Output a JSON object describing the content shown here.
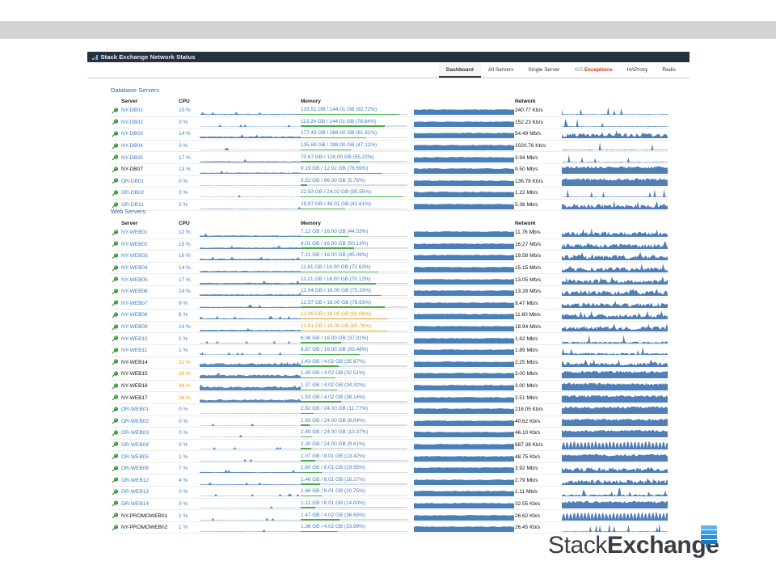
{
  "window": {
    "title": "Stack Exchange Network Status",
    "accent": "#3d7cbf",
    "warn": "#e69a20",
    "ok": "#4da84d"
  },
  "nav": {
    "tabs": [
      {
        "label": "Dashboard",
        "active": true
      },
      {
        "label": "All Servers"
      },
      {
        "label": "Single Server"
      },
      {
        "count": "455",
        "label": "Exceptions",
        "highlight": true
      },
      {
        "label": "HAProxy"
      },
      {
        "label": "Redis"
      }
    ]
  },
  "columns": {
    "server": "Server",
    "cpu": "CPU",
    "memory": "Memory",
    "network": "Network"
  },
  "database_servers": {
    "title": "Database Servers",
    "rows": [
      {
        "name": "NY-DB01",
        "cpu": "10 %",
        "mem": "133.51 GB / 144.01 GB (92.72%)",
        "mem_pct": 92.72,
        "net": "240.77 Kb/s",
        "cpu_level": 0.08,
        "net_style": "spiky"
      },
      {
        "name": "NY-DB02",
        "cpu": "0 %",
        "mem": "113.24 GB / 144.01 GB (78.64%)",
        "mem_pct": 78.64,
        "net": "152.23 Kb/s",
        "cpu_level": 0.03,
        "net_style": "spiky"
      },
      {
        "name": "NY-DB03",
        "cpu": "14 %",
        "mem": "177.43 GB / 288.00 GB (61.61%)",
        "mem_pct": 61.61,
        "net": "54.49 Mb/s",
        "cpu_level": 0.18,
        "net_style": "dense"
      },
      {
        "name": "NY-DB04",
        "cpu": "0 %",
        "mem": "135.69 GB / 288.00 GB (47.12%)",
        "mem_pct": 47.12,
        "net": "1020.76 Kb/s",
        "cpu_level": 0.03,
        "net_style": "spiky"
      },
      {
        "name": "NY-DB05",
        "cpu": "17 %",
        "mem": "70.67 GB / 128.00 GB (55.22%)",
        "mem_pct": 55.22,
        "net": "3.94 Mb/s",
        "cpu_level": 0.12,
        "net_style": "spiky"
      },
      {
        "name": "NY-DB07",
        "cpu": "13 %",
        "mem": "9.19 GB / 12.02 GB (76.59%)",
        "mem_pct": 76.59,
        "net": "9.50 Mb/s",
        "cpu_level": 0.12,
        "net_style": "full",
        "black": true
      },
      {
        "name": "OR-DB01",
        "cpu": "0 %",
        "mem": "5.52 GB / 96.00 GB (5.75%)",
        "mem_pct": 5.75,
        "net": "136.78 Kb/s",
        "cpu_level": 0.03,
        "net_style": "full"
      },
      {
        "name": "OR-DB02",
        "cpu": "0 %",
        "mem": "22.93 GB / 24.02 GB (95.55%)",
        "mem_pct": 95.55,
        "net": "1.22 Mb/s",
        "cpu_level": 0.03,
        "net_style": "spiky"
      },
      {
        "name": "OR-DB11",
        "cpu": "2 %",
        "mem": "19.97 GB / 48.01 GB (41.61%)",
        "mem_pct": 41.61,
        "net": "5.38 Mb/s",
        "cpu_level": 0.05,
        "net_style": "dense"
      }
    ]
  },
  "web_servers": {
    "title": "Web Servers",
    "rows": [
      {
        "name": "NY-WEB01",
        "cpu": "12 %",
        "mem": "7.12 GB / 16.00 GB (44.53%)",
        "mem_pct": 44.53,
        "net": "11.76 Mb/s",
        "cpu_level": 0.14,
        "net_style": "dense"
      },
      {
        "name": "NY-WEB02",
        "cpu": "15 %",
        "mem": "8.01 GB / 16.00 GB (50.13%)",
        "mem_pct": 50.13,
        "net": "16.27 Mb/s",
        "cpu_level": 0.15,
        "net_style": "dense"
      },
      {
        "name": "NY-WEB03",
        "cpu": "16 %",
        "mem": "7.21 GB / 16.00 GB (45.09%)",
        "mem_pct": 45.09,
        "net": "19.58 Mb/s",
        "cpu_level": 0.16,
        "net_style": "dense"
      },
      {
        "name": "NY-WEB04",
        "cpu": "14 %",
        "mem": "11.61 GB / 16.00 GB (72.63%)",
        "mem_pct": 72.63,
        "net": "15.15 Mb/s",
        "cpu_level": 0.15,
        "net_style": "dense"
      },
      {
        "name": "NY-WEB05",
        "cpu": "17 %",
        "mem": "11.21 GB / 16.00 GB (70.12%)",
        "mem_pct": 70.12,
        "net": "13.05 Mb/s",
        "cpu_level": 0.17,
        "net_style": "dense"
      },
      {
        "name": "NY-WEB06",
        "cpu": "14 %",
        "mem": "12.04 GB / 16.00 GB (75.33%)",
        "mem_pct": 75.33,
        "net": "13.28 Mb/s",
        "cpu_level": 0.15,
        "net_style": "dense"
      },
      {
        "name": "NY-WEB07",
        "cpu": "9 %",
        "mem": "12.57 GB / 16.00 GB (78.63%)",
        "mem_pct": 78.63,
        "net": "9.47 Mb/s",
        "cpu_level": 0.11,
        "net_style": "dense"
      },
      {
        "name": "NY-WEB08",
        "cpu": "8 %",
        "mem": "12.96 GB / 16.00 GB (81.06%)",
        "mem_pct": 81.06,
        "net": "11.60 Mb/s",
        "cpu_level": 0.1,
        "net_style": "dense",
        "mem_warn": true
      },
      {
        "name": "NY-WEB09",
        "cpu": "14 %",
        "mem": "12.91 GB / 16.00 GB (80.76%)",
        "mem_pct": 80.76,
        "net": "18.94 Mb/s",
        "cpu_level": 0.15,
        "net_style": "dense",
        "mem_warn": true
      },
      {
        "name": "NY-WEB10",
        "cpu": "1 %",
        "mem": "6.06 GB / 16.00 GB (37.91%)",
        "mem_pct": 37.91,
        "net": "1.62 Mb/s",
        "cpu_level": 0.04,
        "net_style": "sparse"
      },
      {
        "name": "NY-WEB11",
        "cpu": "1 %",
        "mem": "8.87 GB / 16.00 GB (55.48%)",
        "mem_pct": 55.48,
        "net": "1.89 Mb/s",
        "cpu_level": 0.04,
        "net_style": "sparse"
      },
      {
        "name": "NY-WEB14",
        "cpu": "31 %",
        "mem": "1.43 GB / 4.02 GB (35.67%)",
        "mem_pct": 35.67,
        "net": "2.25 Mb/s",
        "cpu_level": 0.35,
        "net_style": "dense",
        "black": true,
        "cpu_warn": true
      },
      {
        "name": "NY-WEB15",
        "cpu": "30 %",
        "mem": "1.30 GB / 4.02 GB (32.51%)",
        "mem_pct": 32.51,
        "net": "3.00 Mb/s",
        "cpu_level": 0.34,
        "net_style": "full",
        "black": true,
        "cpu_warn": true
      },
      {
        "name": "NY-WEB16",
        "cpu": "34 %",
        "mem": "1.37 GB / 4.02 GB (34.32%)",
        "mem_pct": 34.32,
        "net": "3.00 Mb/s",
        "cpu_level": 0.37,
        "net_style": "full",
        "black": true,
        "cpu_warn": true
      },
      {
        "name": "NY-WEB17",
        "cpu": "26 %",
        "mem": "1.53 GB / 4.02 GB (38.14%)",
        "mem_pct": 38.14,
        "net": "2.51 Mb/s",
        "cpu_level": 0.3,
        "net_style": "full",
        "black": true,
        "cpu_warn": true
      },
      {
        "name": "OR-WEB01",
        "cpu": "0 %",
        "mem": "2.82 GB / 24.00 GB (11.77%)",
        "mem_pct": 11.77,
        "net": "218.05 Kb/s",
        "cpu_level": 0.03,
        "net_style": "full"
      },
      {
        "name": "OR-WEB02",
        "cpu": "0 %",
        "mem": "1.93 GB / 24.00 GB (8.04%)",
        "mem_pct": 8.04,
        "net": "40.62 Kb/s",
        "cpu_level": 0.03,
        "net_style": "full"
      },
      {
        "name": "OR-WEB03",
        "cpu": "0 %",
        "mem": "2.49 GB / 24.00 GB (10.37%)",
        "mem_pct": 10.37,
        "net": "46.10 Kb/s",
        "cpu_level": 0.03,
        "net_style": "full"
      },
      {
        "name": "OR-WEB04",
        "cpu": "0 %",
        "mem": "2.30 GB / 24.00 GB (9.61%)",
        "mem_pct": 9.61,
        "net": "887.38 Kb/s",
        "cpu_level": 0.03,
        "net_style": "comb"
      },
      {
        "name": "OR-WEB05",
        "cpu": "1 %",
        "mem": "1.07 GB / 8.01 GB (13.42%)",
        "mem_pct": 13.42,
        "net": "48.75 Kb/s",
        "cpu_level": 0.04,
        "net_style": "full"
      },
      {
        "name": "OR-WEB06",
        "cpu": "7 %",
        "mem": "1.60 GB / 8.01 GB (19.95%)",
        "mem_pct": 19.95,
        "net": "3.92 Mb/s",
        "cpu_level": 0.09,
        "net_style": "dense"
      },
      {
        "name": "OR-WEB12",
        "cpu": "4 %",
        "mem": "1.46 GB / 8.01 GB (18.27%)",
        "mem_pct": 18.27,
        "net": "2.79 Mb/s",
        "cpu_level": 0.07,
        "net_style": "dense"
      },
      {
        "name": "OR-WEB13",
        "cpu": "0 %",
        "mem": "1.66 GB / 8.01 GB (20.75%)",
        "mem_pct": 20.75,
        "net": "1.11 Mb/s",
        "cpu_level": 0.03,
        "net_style": "sparse"
      },
      {
        "name": "OR-WEB14",
        "cpu": "0 %",
        "mem": "1.12 GB / 8.01 GB (14.00%)",
        "mem_pct": 14.0,
        "net": "32.55 Kb/s",
        "cpu_level": 0.03,
        "net_style": "full"
      },
      {
        "name": "NY-PROMOWEB01",
        "cpu": "1 %",
        "mem": "1.47 GB / 4.02 GB (36.65%)",
        "mem_pct": 36.65,
        "net": "26.62 Kb/s",
        "cpu_level": 0.04,
        "net_style": "comb",
        "black": true
      },
      {
        "name": "NY-PROMOWEB02",
        "cpu": "1 %",
        "mem": "1.36 GB / 4.02 GB (33.99%)",
        "mem_pct": 33.99,
        "net": "26.45 Kb/s",
        "cpu_level": 0.04,
        "net_style": "spiky",
        "black": true
      }
    ]
  },
  "logo": {
    "part1": "Stack",
    "part2": "Exchange",
    "color": "#3a3f45",
    "mark_color": "#2d8fd5"
  }
}
